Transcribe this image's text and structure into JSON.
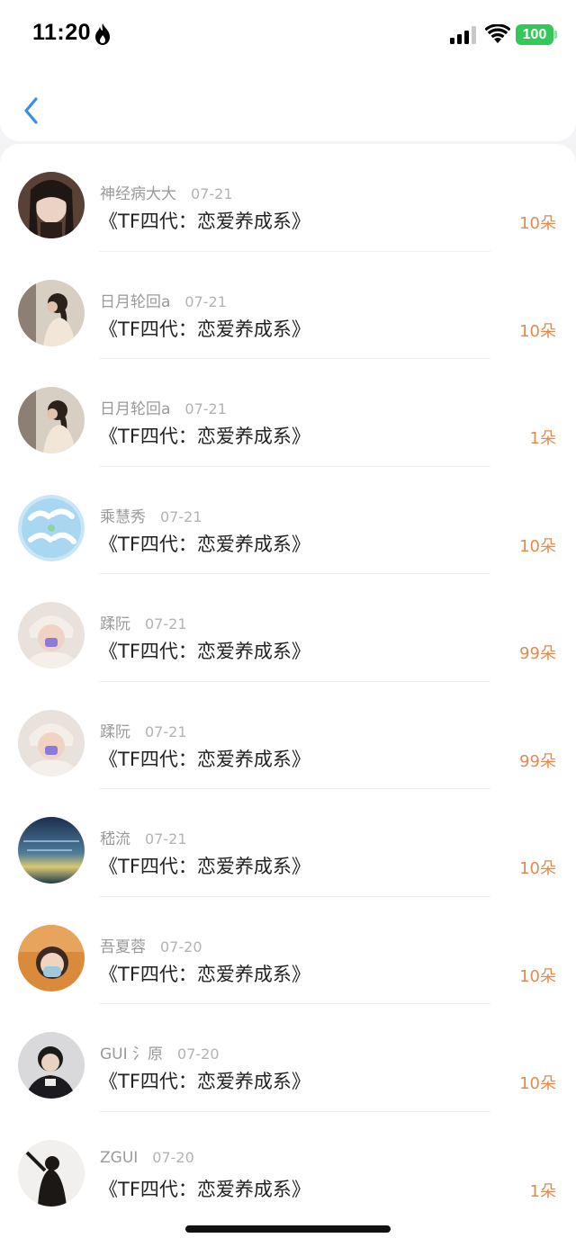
{
  "status_bar": {
    "time": "11:20",
    "battery": "100",
    "colors": {
      "battery": "#34c759"
    }
  },
  "nav": {
    "back_icon": "chevron-left-icon",
    "accent": "#3a8ee6"
  },
  "rows": [
    {
      "username": "神经病大大",
      "date": "07-21",
      "title": "《TF四代：恋爱养成系》",
      "amount": "10朵",
      "avatar": "avatar-photo-icon"
    },
    {
      "username": "日月轮回a",
      "date": "07-21",
      "title": "《TF四代：恋爱养成系》",
      "amount": "10朵",
      "avatar": "avatar-photo-icon"
    },
    {
      "username": "日月轮回a",
      "date": "07-21",
      "title": "《TF四代：恋爱养成系》",
      "amount": "1朵",
      "avatar": "avatar-photo-icon"
    },
    {
      "username": "乘慧秀",
      "date": "07-21",
      "title": "《TF四代：恋爱养成系》",
      "amount": "10朵",
      "avatar": "avatar-photo-icon"
    },
    {
      "username": "蹂阮",
      "date": "07-21",
      "title": "《TF四代：恋爱养成系》",
      "amount": "99朵",
      "avatar": "avatar-photo-icon"
    },
    {
      "username": "蹂阮",
      "date": "07-21",
      "title": "《TF四代：恋爱养成系》",
      "amount": "99朵",
      "avatar": "avatar-photo-icon"
    },
    {
      "username": "嵇流",
      "date": "07-21",
      "title": "《TF四代：恋爱养成系》",
      "amount": "10朵",
      "avatar": "avatar-photo-icon"
    },
    {
      "username": "吾夏蓉",
      "date": "07-20",
      "title": "《TF四代：恋爱养成系》",
      "amount": "10朵",
      "avatar": "avatar-photo-icon"
    },
    {
      "username": "GUI 氵原",
      "date": "07-20",
      "title": "《TF四代：恋爱养成系》",
      "amount": "10朵",
      "avatar": "avatar-photo-icon"
    },
    {
      "username": "ZGUI",
      "date": "07-20",
      "title": "《TF四代：恋爱养成系》",
      "amount": "1朵",
      "avatar": "avatar-photo-icon"
    }
  ],
  "colors": {
    "amount": "#e58a4e",
    "username": "#9a9a9a",
    "title": "#222222"
  }
}
